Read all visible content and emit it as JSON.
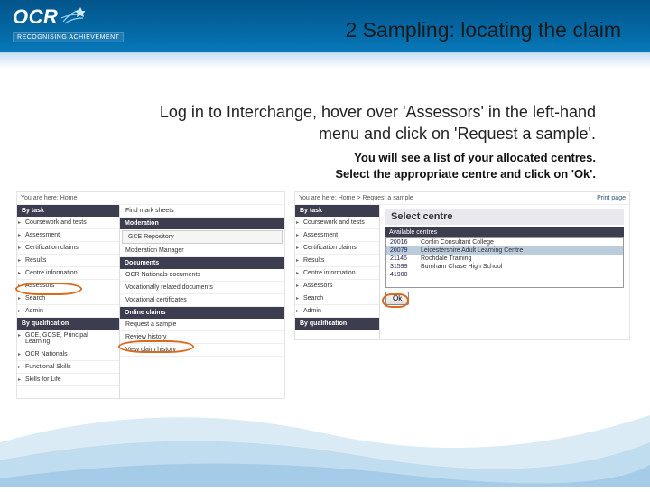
{
  "logo": {
    "brand": "OCR",
    "tagline": "RECOGNISING ACHIEVEMENT"
  },
  "title": "2 Sampling: locating the claim",
  "instruction": "Log in to Interchange, hover over 'Assessors' in the left-hand menu and click on 'Request a sample'.",
  "sub1": "You will see a list of your allocated centres.",
  "sub2": "Select the appropriate centre and click on 'Ok'.",
  "left_pane": {
    "breadcrumb": "You are here: Home",
    "col1": {
      "sect1": "By task",
      "items1": [
        "Coursework and tests",
        "Assessment",
        "Certification claims",
        "Results",
        "Centre information",
        "Assessors",
        "Search",
        "Admin"
      ],
      "sect2": "By qualification",
      "items2": [
        "GCE, GCSE, Principal Learning",
        "OCR Nationals",
        "Functional Skills",
        "Skills for Life"
      ]
    },
    "col2": {
      "top_item": "Find mark sheets",
      "sect1": "Moderation",
      "items1": [
        "GCE Repository",
        "Moderation Manager"
      ],
      "sect2": "Documents",
      "items2": [
        "OCR Nationals documents",
        "Vocationally related documents",
        "Vocational certificates"
      ],
      "sect3": "Online claims",
      "items3": [
        "Request a sample",
        "Review history",
        "View claim history"
      ]
    }
  },
  "right_pane": {
    "breadcrumb": "You are here: Home > Request a sample",
    "print": "Print page",
    "sidebar": {
      "sect1": "By task",
      "items1": [
        "Coursework and tests",
        "Assessment",
        "Certification claims",
        "Results",
        "Centre information",
        "Assessors",
        "Search",
        "Admin"
      ],
      "sect2": "By qualification"
    },
    "title": "Select centre",
    "avail": "Available centres",
    "rows": [
      {
        "code": "20016",
        "name": "Conlin Consultant College"
      },
      {
        "code": "20079",
        "name": "Leicestershire Adult Learning Centre"
      },
      {
        "code": "21146",
        "name": "Rochdale Training"
      },
      {
        "code": "31599",
        "name": "Burnham Chase High School"
      },
      {
        "code": "41900",
        "name": ""
      }
    ],
    "ok": "Ok"
  }
}
